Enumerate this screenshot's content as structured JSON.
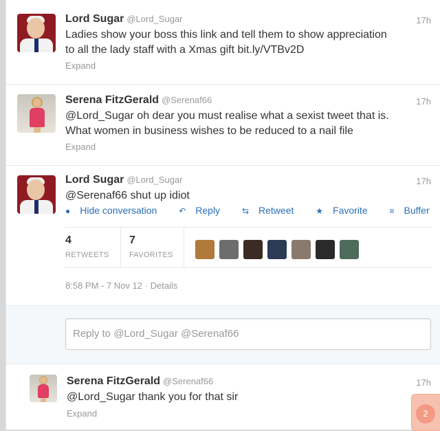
{
  "tweets": [
    {
      "name": "Lord Sugar",
      "handle": "@Lord_Sugar",
      "time": "17h",
      "text_line1": "Ladies show your boss this link and tell them to show appreciation",
      "text_line2": "to all the lady staff with a Xmas gift bit.ly/VTBv2D",
      "expand": "Expand"
    },
    {
      "name": "Serena FitzGerald",
      "handle": "@Serenaf66",
      "time": "17h",
      "text_line1": "@Lord_Sugar oh dear you must realise what a sexist tweet that is.",
      "text_line2": "What women in business wishes to be reduced to a nail file",
      "expand": "Expand"
    },
    {
      "name": "Lord Sugar",
      "handle": "@Lord_Sugar",
      "time": "17h",
      "text_line1": "@Serenaf66 shut up idiot"
    },
    {
      "name": "Serena FitzGerald",
      "handle": "@Serenaf66",
      "time": "17h",
      "text_line1": "@Lord_Sugar thank you for that sir",
      "expand": "Expand"
    }
  ],
  "actions": {
    "hide_conversation": "Hide conversation",
    "reply": "Reply",
    "retweet": "Retweet",
    "favorite": "Favorite",
    "buffer": "Buffer"
  },
  "stats": {
    "retweets_count": "4",
    "retweets_label": "RETWEETS",
    "favorites_count": "7",
    "favorites_label": "FAVORITES"
  },
  "favoriters": [
    {
      "icon": "avatar-1",
      "color": "#b07a3a"
    },
    {
      "icon": "avatar-2",
      "color": "#6d6d6d"
    },
    {
      "icon": "avatar-3",
      "color": "#3b2b25"
    },
    {
      "icon": "avatar-4",
      "color": "#2b3a55"
    },
    {
      "icon": "avatar-5",
      "color": "#8a7a6d"
    },
    {
      "icon": "avatar-6",
      "color": "#2a2a2a"
    },
    {
      "icon": "avatar-7",
      "color": "#4d6a5a"
    }
  ],
  "meta": {
    "timestamp": "8:58 PM - 7 Nov 12",
    "separator": "·",
    "details": "Details"
  },
  "reply": {
    "placeholder": "Reply to @Lord_Sugar @Serenaf66"
  },
  "badge": {
    "count": "2"
  },
  "colors": {
    "link": "#2b6fb6",
    "muted": "#999999",
    "badge": "#f29a84"
  }
}
